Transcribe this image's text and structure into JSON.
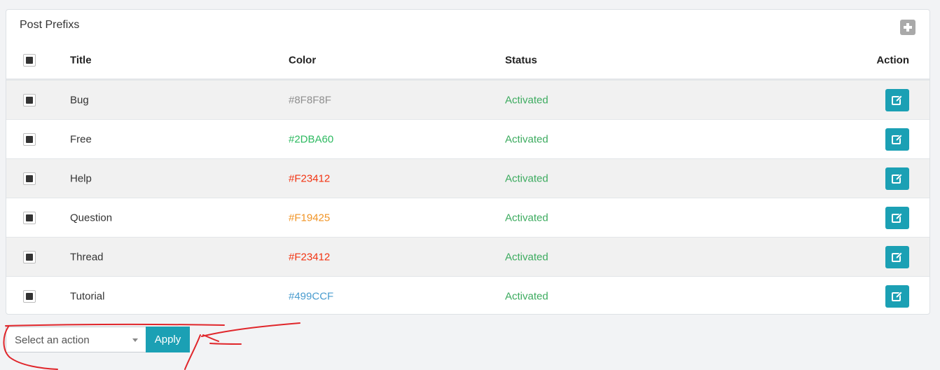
{
  "panel": {
    "title": "Post Prefixs",
    "add_icon": "plus-square-icon"
  },
  "table": {
    "headers": {
      "title": "Title",
      "color": "Color",
      "status": "Status",
      "action": "Action"
    },
    "rows": [
      {
        "title": "Bug",
        "color": "#8F8F8F",
        "status": "Activated"
      },
      {
        "title": "Free",
        "color": "#2DBA60",
        "status": "Activated"
      },
      {
        "title": "Help",
        "color": "#F23412",
        "status": "Activated"
      },
      {
        "title": "Question",
        "color": "#F19425",
        "status": "Activated"
      },
      {
        "title": "Thread",
        "color": "#F23412",
        "status": "Activated"
      },
      {
        "title": "Tutorial",
        "color": "#499CCF",
        "status": "Activated"
      }
    ],
    "edit_icon": "edit-icon"
  },
  "bulk_action": {
    "select_placeholder": "Select an action",
    "apply_label": "Apply"
  },
  "colors": {
    "accent": "#1BA0B4",
    "status_active": "#3CAB5F",
    "annotation": "#E0262B"
  }
}
